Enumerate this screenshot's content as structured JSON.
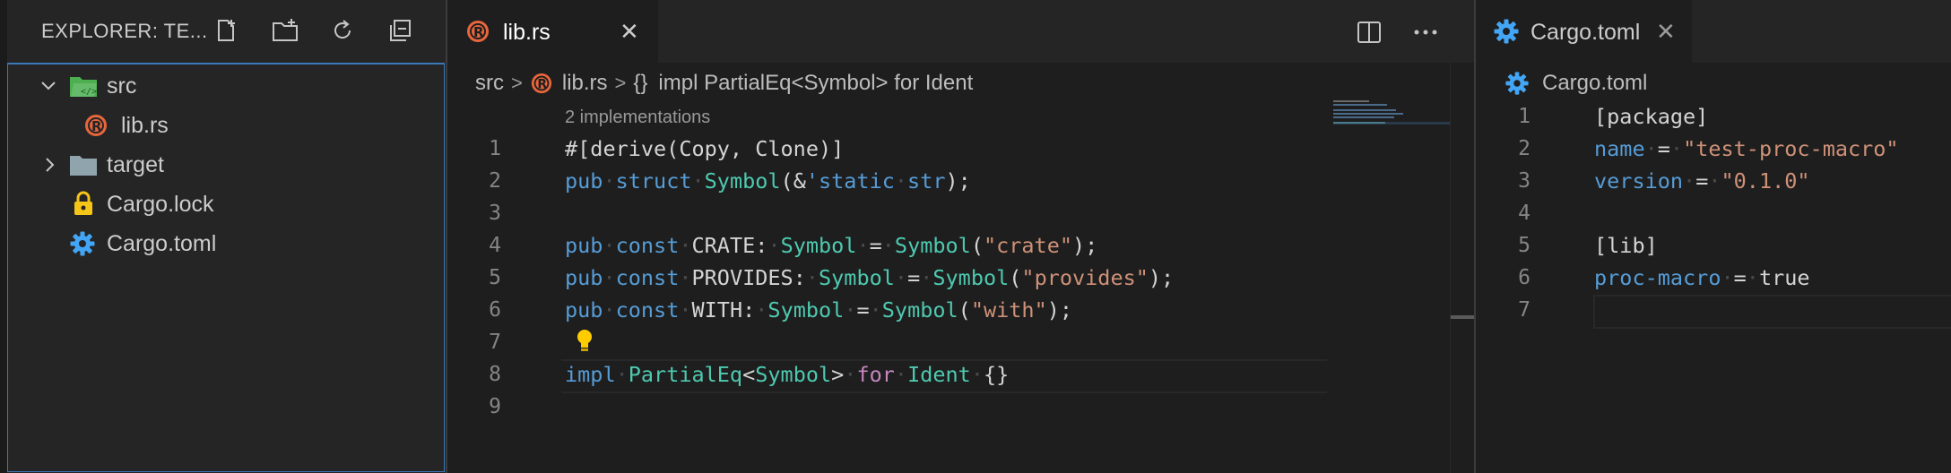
{
  "explorer": {
    "title": "EXPLORER: TE...",
    "actions": [
      "new-file-icon",
      "new-folder-icon",
      "refresh-icon",
      "collapse-all-icon"
    ],
    "items": [
      {
        "label": "src",
        "type": "folder-open"
      },
      {
        "label": "lib.rs",
        "type": "rust-file"
      },
      {
        "label": "target",
        "type": "folder-closed"
      },
      {
        "label": "Cargo.lock",
        "type": "lock-file"
      },
      {
        "label": "Cargo.toml",
        "type": "toml-file"
      }
    ]
  },
  "editor1": {
    "tab": {
      "label": "lib.rs",
      "close": "✕"
    },
    "actions": [
      "split-editor-icon",
      "more-actions-icon"
    ],
    "breadcrumb": {
      "folder": "src",
      "file": "lib.rs",
      "symbol_glyph": "{}",
      "symbol": "impl PartialEq<Symbol> for Ident"
    },
    "codelens": "2 implementations",
    "line_numbers": [
      "1",
      "2",
      "3",
      "4",
      "5",
      "6",
      "7",
      "8",
      "9"
    ],
    "lines": [
      [
        [
          "p",
          "#[derive(Copy, Clone)]"
        ]
      ],
      [
        [
          "k",
          "pub"
        ],
        [
          "ws",
          "·"
        ],
        [
          "k",
          "struct"
        ],
        [
          "ws",
          "·"
        ],
        [
          "t",
          "Symbol"
        ],
        [
          "p",
          "(&"
        ],
        [
          "k",
          "'static"
        ],
        [
          "ws",
          "·"
        ],
        [
          "k",
          "str"
        ],
        [
          "p",
          ");"
        ]
      ],
      [],
      [
        [
          "k",
          "pub"
        ],
        [
          "ws",
          "·"
        ],
        [
          "k",
          "const"
        ],
        [
          "ws",
          "·"
        ],
        [
          "p",
          "CRATE:"
        ],
        [
          "ws",
          "·"
        ],
        [
          "t",
          "Symbol"
        ],
        [
          "ws",
          "·"
        ],
        [
          "p",
          "="
        ],
        [
          "ws",
          "·"
        ],
        [
          "t",
          "Symbol"
        ],
        [
          "p",
          "("
        ],
        [
          "s",
          "\"crate\""
        ],
        [
          "p",
          ");"
        ]
      ],
      [
        [
          "k",
          "pub"
        ],
        [
          "ws",
          "·"
        ],
        [
          "k",
          "const"
        ],
        [
          "ws",
          "·"
        ],
        [
          "p",
          "PROVIDES:"
        ],
        [
          "ws",
          "·"
        ],
        [
          "t",
          "Symbol"
        ],
        [
          "ws",
          "·"
        ],
        [
          "p",
          "="
        ],
        [
          "ws",
          "·"
        ],
        [
          "t",
          "Symbol"
        ],
        [
          "p",
          "("
        ],
        [
          "s",
          "\"provides\""
        ],
        [
          "p",
          ");"
        ]
      ],
      [
        [
          "k",
          "pub"
        ],
        [
          "ws",
          "·"
        ],
        [
          "k",
          "const"
        ],
        [
          "ws",
          "·"
        ],
        [
          "p",
          "WITH:"
        ],
        [
          "ws",
          "·"
        ],
        [
          "t",
          "Symbol"
        ],
        [
          "ws",
          "·"
        ],
        [
          "p",
          "="
        ],
        [
          "ws",
          "·"
        ],
        [
          "t",
          "Symbol"
        ],
        [
          "p",
          "("
        ],
        [
          "s",
          "\"with\""
        ],
        [
          "p",
          ");"
        ]
      ],
      [],
      [
        [
          "k",
          "impl"
        ],
        [
          "ws",
          "·"
        ],
        [
          "t",
          "PartialEq"
        ],
        [
          "p",
          "<"
        ],
        [
          "t",
          "Symbol"
        ],
        [
          "p",
          ">"
        ],
        [
          "ws",
          "·"
        ],
        [
          "kp",
          "for"
        ],
        [
          "ws",
          "·"
        ],
        [
          "t",
          "Ident"
        ],
        [
          "ws",
          "·"
        ],
        [
          "p",
          "{}"
        ]
      ],
      []
    ]
  },
  "editor2": {
    "tab": {
      "label": "Cargo.toml",
      "close": "✕"
    },
    "breadcrumb": {
      "file": "Cargo.toml"
    },
    "line_numbers": [
      "1",
      "2",
      "3",
      "4",
      "5",
      "6",
      "7"
    ],
    "lines": [
      [
        [
          "p",
          "[package]"
        ]
      ],
      [
        [
          "k",
          "name"
        ],
        [
          "ws",
          "·"
        ],
        [
          "p",
          "="
        ],
        [
          "ws",
          "·"
        ],
        [
          "s",
          "\"test-proc-macro\""
        ]
      ],
      [
        [
          "k",
          "version"
        ],
        [
          "ws",
          "·"
        ],
        [
          "p",
          "="
        ],
        [
          "ws",
          "·"
        ],
        [
          "s",
          "\"0.1.0\""
        ]
      ],
      [],
      [
        [
          "p",
          "[lib]"
        ]
      ],
      [
        [
          "k",
          "proc-macro"
        ],
        [
          "ws",
          "·"
        ],
        [
          "p",
          "="
        ],
        [
          "ws",
          "·"
        ],
        [
          "p",
          "true"
        ]
      ],
      []
    ]
  },
  "colors": {
    "rust": "#e8663c",
    "gear": "#42a5f5",
    "folder_src": "#4caf50",
    "folder": "#90a4ae",
    "lock": "#f5c518",
    "lightbulb": "#ffcc00"
  }
}
